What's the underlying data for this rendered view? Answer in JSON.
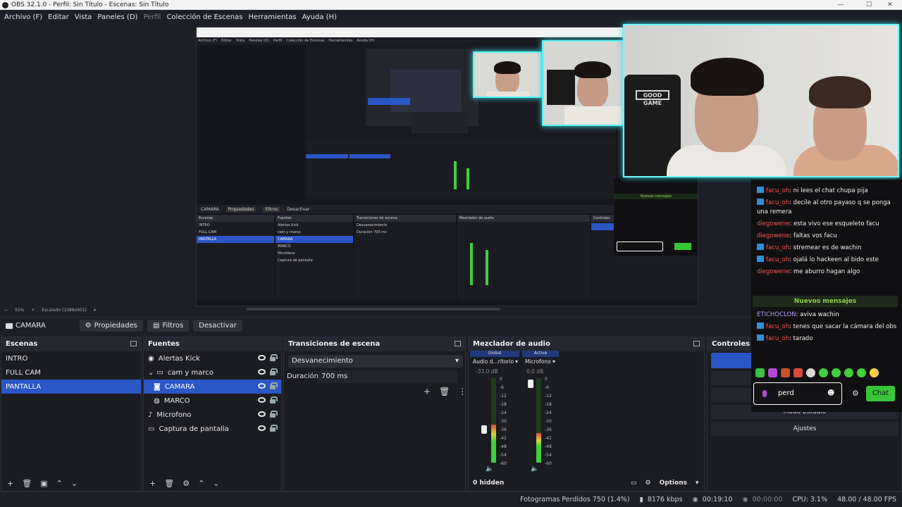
{
  "window": {
    "title": "OBS 32.1.0 - Perfil: Sin Título - Escenas: Sin Título"
  },
  "menu": {
    "items": [
      "Archivo (F)",
      "Editar",
      "Vista",
      "Paneles (D)",
      "Perfil",
      "Colección de Escenas",
      "Herramientas",
      "Ayuda (H)"
    ]
  },
  "preview": {
    "zoom": "55%",
    "scale_label": "Escalado (1088x601)"
  },
  "source_bar": {
    "current_source": "CAMARA",
    "properties_label": "Propiedades",
    "filters_label": "Filtros",
    "deactivate_label": "Desactivar"
  },
  "scenes": {
    "title": "Escenas",
    "items": [
      "INTRO",
      "FULL CAM",
      "PANTALLA"
    ],
    "selected": "PANTALLA"
  },
  "sources": {
    "title": "Fuentes",
    "items": [
      "Alertas Kick",
      "cam y marco",
      "CAMARA",
      "MARCO",
      "Microfono",
      "Captura de pantalla"
    ],
    "selected": "CAMARA"
  },
  "transitions": {
    "title": "Transiciones de escena",
    "type": "Desvanecimiento",
    "duration_label": "Duración",
    "duration_value": "700 ms"
  },
  "mixer": {
    "title": "Mezclador de audio",
    "channels": [
      {
        "tag": "Global",
        "name": "Audio d...ritorio",
        "db": "-33.0 dB",
        "level": 0.45
      },
      {
        "tag": "Active",
        "name": "Microfono",
        "db": "0.0 dB",
        "level": 0.35
      }
    ],
    "scale": [
      "0",
      "-6",
      "-12",
      "-18",
      "-24",
      "-30",
      "-36",
      "-42",
      "-48",
      "-54",
      "-60"
    ],
    "hidden": "0 hidden",
    "options": "Options"
  },
  "controls": {
    "title": "Controles",
    "studio_mode": "Modo Estudio",
    "settings": "Ajustes"
  },
  "status": {
    "dropped": "Fotogramas Perdidos 750 (1.4%)",
    "bitrate": "8176 kbps",
    "stream_time": "00:19:10",
    "rec_time": "00:00:00",
    "cpu": "CPU: 3.1%",
    "fps": "48.00 / 48.00 FPS"
  },
  "chat": {
    "messages": [
      {
        "user": "facu_oh",
        "text": ": ni lees el chat chupa pija",
        "badge": true,
        "color": "#ff5050"
      },
      {
        "user": "facu_oh",
        "text": ": decile al otro payaso q se ponga una remera",
        "badge": true,
        "color": "#ff5050"
      },
      {
        "user": "diegowene",
        "text": ": esta vivo ese esqueleto facu",
        "badge": false,
        "color": "#ff5050"
      },
      {
        "user": "diegowene",
        "text": ": faltas vos facu",
        "badge": false,
        "color": "#ff5050"
      },
      {
        "user": "facu_oh",
        "text": ": stremear es de wachin",
        "badge": true,
        "color": "#ff5050"
      },
      {
        "user": "facu_oh",
        "text": ": ojalá lo hackeen al bido este",
        "badge": true,
        "color": "#ff5050"
      },
      {
        "user": "diegowene",
        "text": ": me aburro hagan algo",
        "badge": false,
        "color": "#ff5050"
      }
    ],
    "new_messages_label": "Nuevos mensajes",
    "messages_after": [
      {
        "user": "ETICHOCLON",
        "text": ": aviva wachin",
        "badge": false,
        "color": "#b496ff"
      },
      {
        "user": "facu_oh",
        "text": ": tenes que sacar la cámara del obs",
        "badge": true,
        "color": "#ff5050"
      },
      {
        "user": "facu_oh",
        "text": ": tarado",
        "badge": true,
        "color": "#ff5050"
      }
    ],
    "input_value": "perd",
    "send_label": "Chat"
  }
}
